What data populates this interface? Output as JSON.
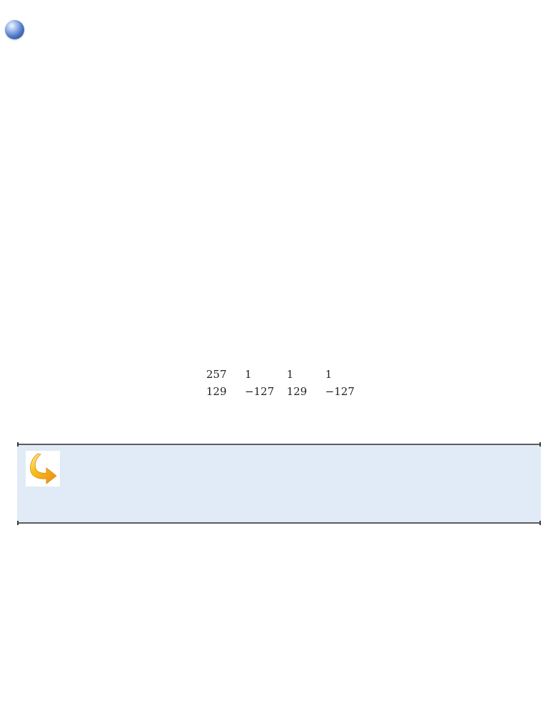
{
  "icons": {
    "section_bullet": "blue-sphere-bullet-icon",
    "note_marker": "curved-arrow-icon"
  },
  "colors": {
    "note_background": "#e1ebf7",
    "note_border": "#5c5c5c",
    "bullet_blue": "#4f78c6",
    "arrow_yellow": "#f6c21c",
    "arrow_orange": "#ee8a12"
  },
  "table": {
    "rows": [
      [
        "257",
        "1",
        "1",
        "1"
      ],
      [
        "129",
        "−127",
        "129",
        "−127"
      ]
    ]
  }
}
